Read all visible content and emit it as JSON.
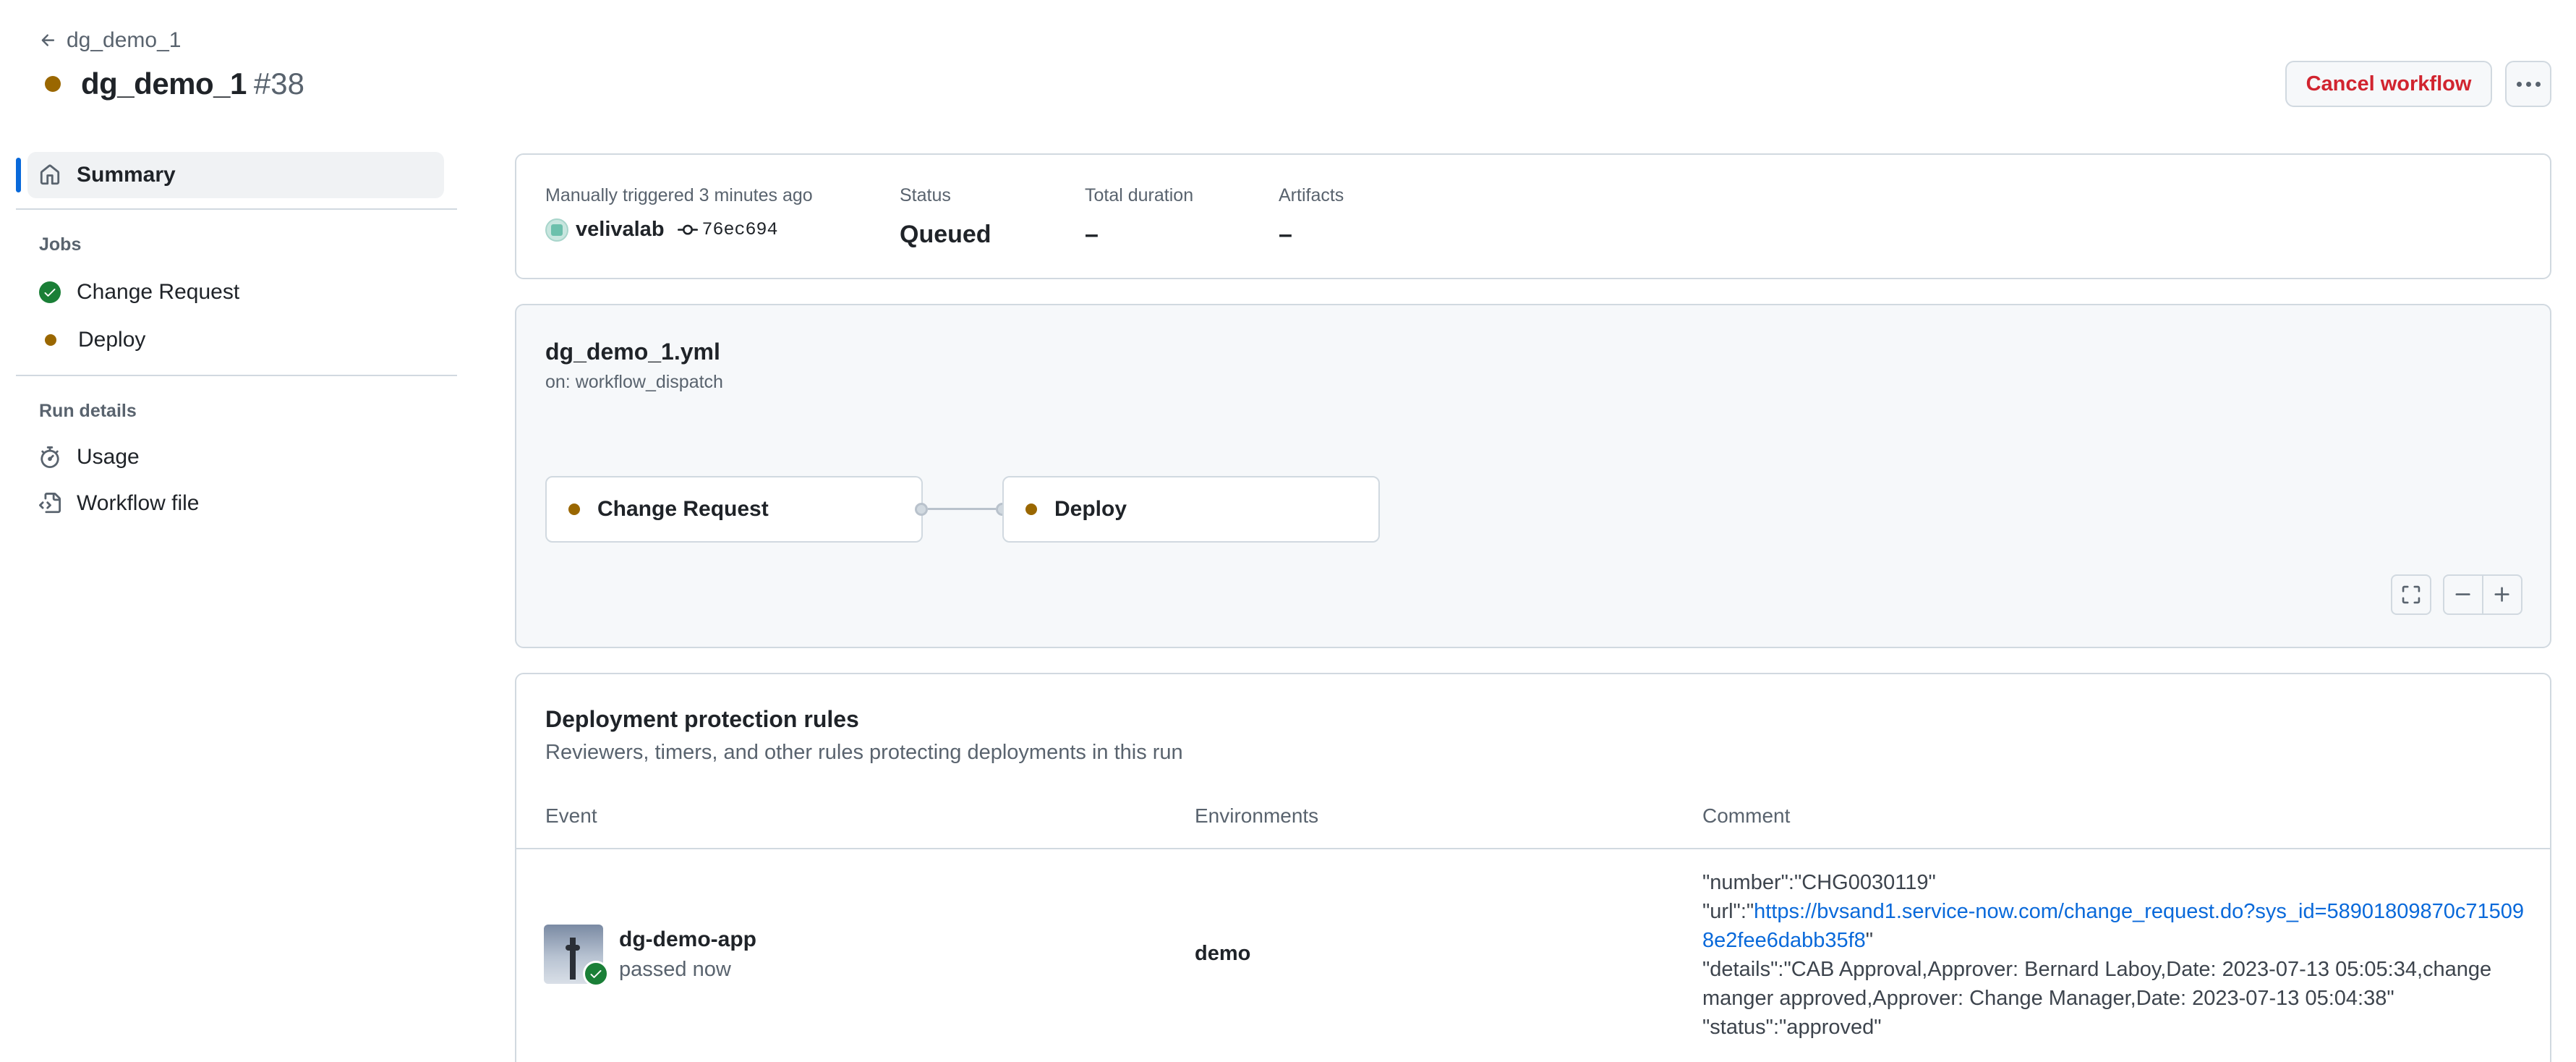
{
  "header": {
    "back_label": "dg_demo_1",
    "title": "dg_demo_1",
    "run_number": "#38",
    "cancel_label": "Cancel workflow",
    "status_color": "#9a6700"
  },
  "sidebar": {
    "summary_label": "Summary",
    "jobs_heading": "Jobs",
    "jobs": [
      {
        "label": "Change Request",
        "status": "success"
      },
      {
        "label": "Deploy",
        "status": "queued"
      }
    ],
    "run_details_heading": "Run details",
    "usage_label": "Usage",
    "workflow_file_label": "Workflow file"
  },
  "summary": {
    "trigger_label": "Manually triggered 3 minutes ago",
    "user": "velivalab",
    "commit": "76ec694",
    "status_label": "Status",
    "status_value": "Queued",
    "duration_label": "Total duration",
    "duration_value": "–",
    "artifacts_label": "Artifacts",
    "artifacts_value": "–"
  },
  "graph": {
    "file": "dg_demo_1.yml",
    "trigger": "on: workflow_dispatch",
    "nodes": [
      {
        "label": "Change Request"
      },
      {
        "label": "Deploy"
      }
    ]
  },
  "rules": {
    "title": "Deployment protection rules",
    "subtitle": "Reviewers, timers, and other rules protecting deployments in this run",
    "columns": [
      "Event",
      "Environments",
      "Comment"
    ],
    "row": {
      "app": "dg-demo-app",
      "app_status": "passed now",
      "environment": "demo",
      "comment_number": "\"number\":\"CHG0030119\"",
      "comment_url_prefix": "\"url\":\"",
      "comment_url": "https://bvsand1.service-now.com/change_request.do?sys_id=58901809870c715098e2fee6dabb35f8",
      "comment_url_suffix": "\"",
      "comment_details": "\"details\":\"CAB Approval,Approver: Bernard Laboy,Date: 2023-07-13 05:05:34,change manger approved,Approver: Change Manager,Date: 2023-07-13 05:04:38\"",
      "comment_status": "\"status\":\"approved\""
    }
  }
}
